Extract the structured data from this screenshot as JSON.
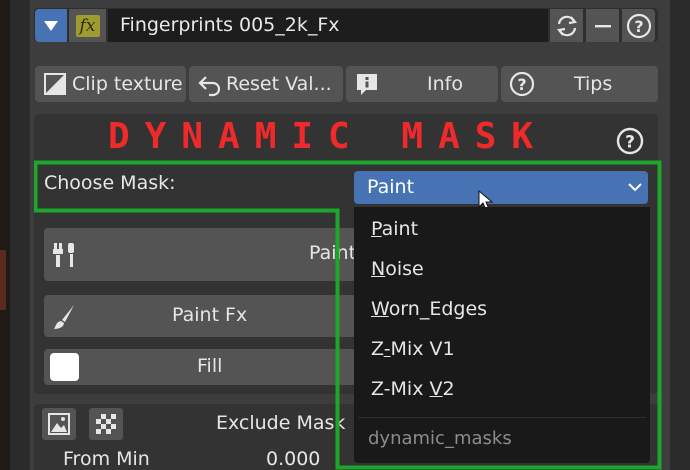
{
  "header": {
    "collapse_icon": "triangle-down-icon",
    "fx_icon": "fx",
    "name": "Fingerprints 005_2k_Fx",
    "icons": [
      "refresh-icon",
      "minus-icon",
      "help-icon"
    ]
  },
  "toolbar": [
    {
      "label": "Clip texture",
      "icon": "clip-texture-icon"
    },
    {
      "label": "Reset Val...",
      "icon": "reset-icon"
    },
    {
      "label": "Info",
      "icon": "info-icon"
    },
    {
      "label": "Tips",
      "icon": "help-icon"
    }
  ],
  "section": {
    "title": "DYNAMIC MASK",
    "choose_label": "Choose Mask:",
    "selected": "Paint",
    "paint_btn": "Paint",
    "paint_fx_btn": "Paint Fx",
    "fill_btn": "Fill"
  },
  "bottom": {
    "exclude_label": "Exclude Mask",
    "from_min_label": "From Min",
    "from_min_value": "0.000"
  },
  "menu": {
    "items": [
      {
        "label": "Paint",
        "underline": "P",
        "rest": "aint"
      },
      {
        "label": "Noise",
        "underline": "N",
        "rest": "oise"
      },
      {
        "label": "Worn_Edges",
        "underline": "W",
        "rest": "orn_Edges"
      },
      {
        "label": "Z-Mix V1",
        "prefix": "Z",
        "underline": "-",
        "rest": "Mix V1"
      },
      {
        "label": "Z-Mix V2",
        "prefix": "Z-Mix ",
        "underline": "V",
        "rest": "2"
      }
    ],
    "footer": "dynamic_masks"
  },
  "colors": {
    "accent": "#4772b3",
    "title": "#ee2a2a",
    "highlight": "#1ea62c",
    "button": "#545454",
    "panel": "#3d3d3d"
  }
}
